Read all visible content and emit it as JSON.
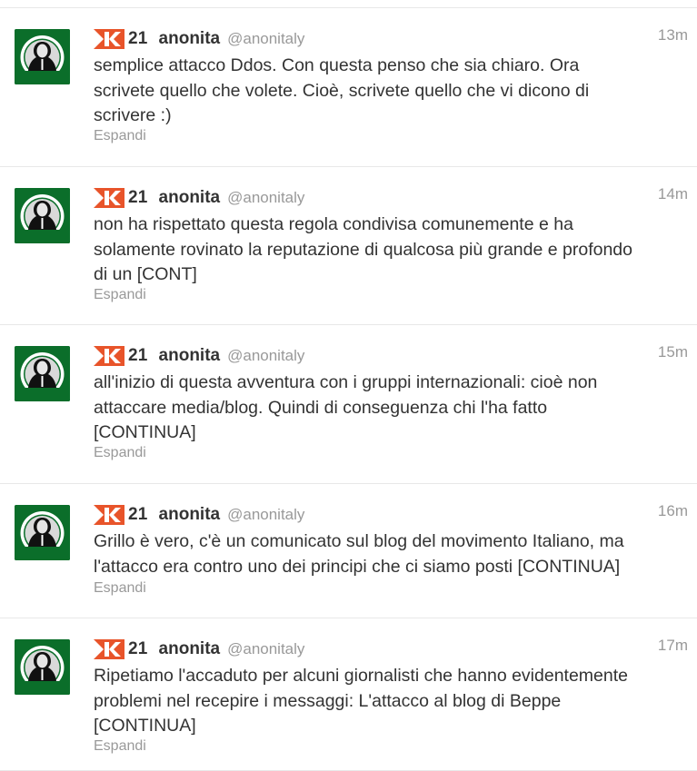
{
  "tweets": [
    {
      "klout_score": "21",
      "fullname": "anonita",
      "username": "@anonitaly",
      "time": "13m",
      "lines": [
        "semplice attacco Ddos. Con questa penso che sia chiaro. Ora",
        "scrivete quello che volete. Cioè, scrivete quello che vi dicono di",
        "scrivere :)"
      ],
      "expand_label": "Espandi"
    },
    {
      "klout_score": "21",
      "fullname": "anonita",
      "username": "@anonitaly",
      "time": "14m",
      "lines": [
        "non ha rispettato questa regola condivisa comunemente e ha",
        "solamente rovinato la reputazione di qualcosa più grande e profondo",
        "di un [CONT]"
      ],
      "expand_label": "Espandi"
    },
    {
      "klout_score": "21",
      "fullname": "anonita",
      "username": "@anonitaly",
      "time": "15m",
      "lines": [
        "all'inizio di questa avventura con i gruppi internazionali: cioè non",
        "attaccare media/blog. Quindi di conseguenza chi l'ha fatto",
        "[CONTINUA]"
      ],
      "expand_label": "Espandi"
    },
    {
      "klout_score": "21",
      "fullname": "anonita",
      "username": "@anonitaly",
      "time": "16m",
      "lines": [
        "Grillo è vero, c'è un comunicato sul blog del movimento Italiano, ma",
        "l'attacco era contro uno dei principi che ci siamo posti [CONTINUA]"
      ],
      "expand_label": "Espandi"
    },
    {
      "klout_score": "21",
      "fullname": "anonita",
      "username": "@anonitaly",
      "time": "17m",
      "lines": [
        "Ripetiamo l'accaduto per alcuni giornalisti che hanno evidentemente",
        "problemi nel recepire i messaggi: L'attacco al blog di Beppe",
        "[CONTINUA]"
      ],
      "expand_label": "Espandi"
    }
  ],
  "icons": {
    "avatar": "anonymous-mask-avatar-icon",
    "klout": "klout-k-icon"
  },
  "colors": {
    "klout_orange": "#e8542a",
    "avatar_green": "#0b6e2a",
    "meta_gray": "#999999",
    "text": "#333333"
  }
}
